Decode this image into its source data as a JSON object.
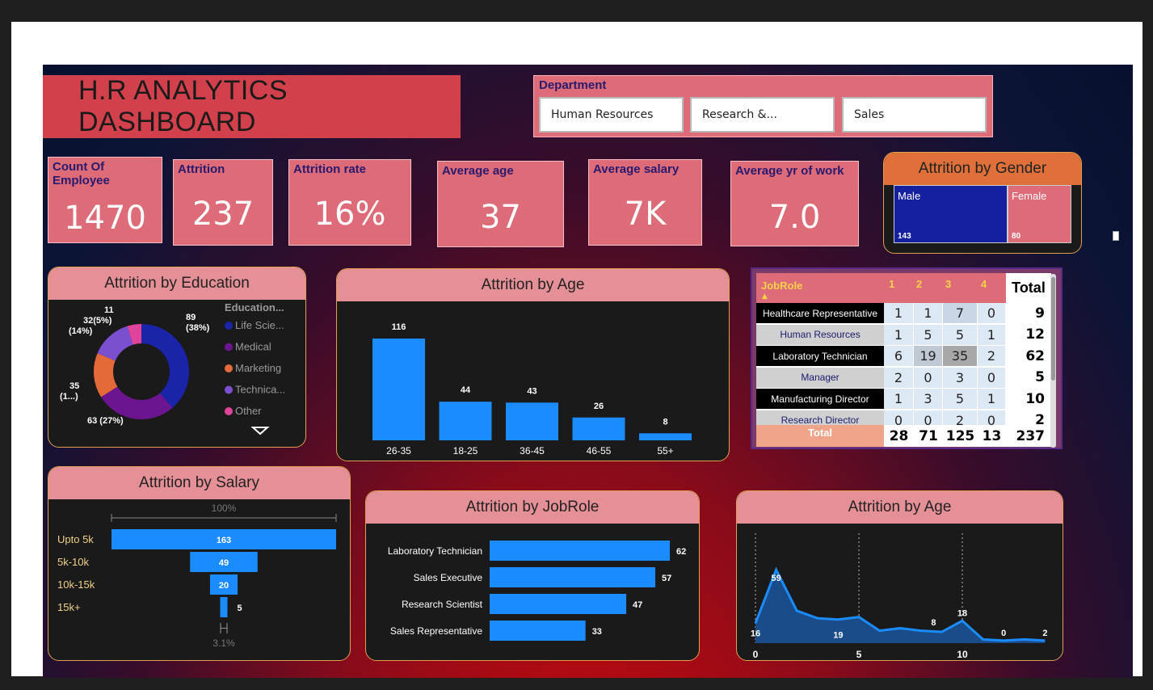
{
  "title": "H.R ANALYTICS DASHBOARD",
  "slicer": {
    "label": "Department",
    "options": [
      "Human Resources",
      "Research &...",
      "Sales"
    ]
  },
  "kpis": [
    {
      "label": "Count Of Employee",
      "value": "1470"
    },
    {
      "label": "Attrition",
      "value": "237"
    },
    {
      "label": "Attrition rate",
      "value": "16%"
    },
    {
      "label": "Average age",
      "value": "37"
    },
    {
      "label": "Average salary",
      "value": "7K"
    },
    {
      "label": "Average yr of work",
      "value": "7.0"
    }
  ],
  "gender": {
    "title": "Attrition by Gender",
    "male_label": "Male",
    "male_value": "143",
    "female_label": "Female",
    "female_value": "80"
  },
  "colors": {
    "accent_blue": "#1a8cff",
    "navy": "#1520a0",
    "pink": "#dd6b78",
    "header_pink": "#e58f97",
    "title_red": "#d2404c",
    "gold": "#e0a050"
  },
  "education": {
    "title": "Attrition by Education",
    "legend_title": "Education...",
    "legend": [
      {
        "name": "Life Scie...",
        "color": "#1a24a8"
      },
      {
        "name": "Medical",
        "color": "#6b1590"
      },
      {
        "name": "Marketing",
        "color": "#e56a3a"
      },
      {
        "name": "Technica...",
        "color": "#7a4fd0"
      },
      {
        "name": "Other",
        "color": "#e0449a"
      }
    ],
    "labels": [
      "89",
      "(38%)",
      "63 (27%)",
      "35",
      "(1...)",
      "32(5%)",
      "(14%)",
      "11"
    ]
  },
  "chart_data": [
    {
      "type": "bar",
      "title": "Attrition by Age",
      "categories": [
        "26-35",
        "18-25",
        "36-45",
        "46-55",
        "55+"
      ],
      "values": [
        116,
        44,
        43,
        26,
        8
      ]
    },
    {
      "type": "pie",
      "title": "Attrition by Education",
      "categories": [
        "Life Scie...",
        "Medical",
        "Marketing",
        "Technica...",
        "Other"
      ],
      "values": [
        89,
        63,
        35,
        32,
        11
      ]
    },
    {
      "type": "bar",
      "title": "Attrition by Salary",
      "categories": [
        "Upto 5k",
        "5k-10k",
        "10k-15k",
        "15k+"
      ],
      "values": [
        163,
        49,
        20,
        5
      ],
      "top_label": "100%",
      "bottom_label": "3.1%"
    },
    {
      "type": "bar",
      "title": "Attrition by JobRole",
      "categories": [
        "Laboratory Technician",
        "Sales Executive",
        "Research Scientist",
        "Sales Representative"
      ],
      "values": [
        62,
        57,
        47,
        33
      ]
    },
    {
      "type": "area",
      "title": "Attrition by Age",
      "x": [
        0,
        1,
        2,
        3,
        4,
        5,
        6,
        7,
        8,
        9,
        10,
        11,
        12,
        13,
        14
      ],
      "values": [
        16,
        59,
        26,
        20,
        19,
        21,
        10,
        12,
        10,
        9,
        18,
        3,
        2,
        3,
        2
      ],
      "point_labels": [
        "16",
        "59",
        "19",
        "8",
        "18",
        "0",
        "2"
      ],
      "x_ticks": [
        "0",
        "5",
        "10"
      ]
    },
    {
      "type": "table",
      "title": "JobRole",
      "columns": [
        "JobRole",
        "1",
        "2",
        "3",
        "4",
        "Total"
      ],
      "rows": [
        {
          "role": "Healthcare Representative",
          "v": [
            "1",
            "1",
            "7",
            "0"
          ],
          "total": "9"
        },
        {
          "role": "Human Resources",
          "v": [
            "1",
            "5",
            "5",
            "1"
          ],
          "total": "12"
        },
        {
          "role": "Laboratory Technician",
          "v": [
            "6",
            "19",
            "35",
            "2"
          ],
          "total": "62"
        },
        {
          "role": "Manager",
          "v": [
            "2",
            "0",
            "3",
            "0"
          ],
          "total": "5"
        },
        {
          "role": "Manufacturing Director",
          "v": [
            "1",
            "3",
            "5",
            "1"
          ],
          "total": "10"
        },
        {
          "role": "Research Director",
          "v": [
            "0",
            "0",
            "2",
            "0"
          ],
          "total": "2"
        }
      ],
      "totals_label": "Total",
      "totals": [
        "28",
        "71",
        "125",
        "13",
        "237"
      ]
    }
  ]
}
